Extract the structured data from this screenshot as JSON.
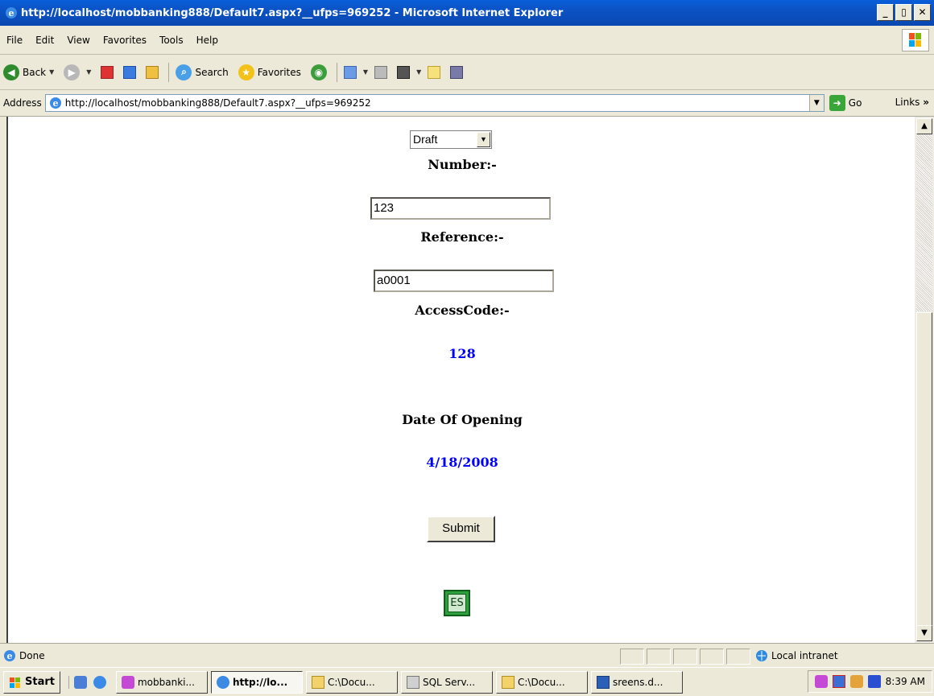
{
  "window": {
    "title": "http://localhost/mobbanking888/Default7.aspx?__ufps=969252 - Microsoft Internet Explorer",
    "minimize": "_",
    "maximize": "▯",
    "close": "✕"
  },
  "menu": {
    "items": [
      "File",
      "Edit",
      "View",
      "Favorites",
      "Tools",
      "Help"
    ]
  },
  "toolbar": {
    "back_label": "Back",
    "search_label": "Search",
    "favorites_label": "Favorites"
  },
  "address": {
    "label": "Address",
    "url": "http://localhost/mobbanking888/Default7.aspx?__ufps=969252",
    "go_label": "Go",
    "links_label": "Links",
    "links_chevron": "»"
  },
  "form": {
    "type_select_value": "Draft",
    "number_label": "Number:-",
    "number_value": "123",
    "reference_label": "Reference:-",
    "reference_value": "a0001",
    "accesscode_label": "AccessCode:-",
    "accesscode_value": "128",
    "date_label": "Date Of Opening",
    "date_value": "4/18/2008",
    "submit_label": "Submit",
    "logo_text": "ES"
  },
  "status": {
    "text": "Done",
    "zone": "Local intranet"
  },
  "taskbar": {
    "start_label": "Start",
    "tasks": [
      "mobbanki...",
      "http://lo...",
      "C:\\Docu...",
      "SQL Serv...",
      "C:\\Docu...",
      "sreens.d..."
    ],
    "clock": "8:39 AM"
  },
  "colors": {
    "titlebar": "#0a52c4",
    "value_text": "#0000ff"
  }
}
